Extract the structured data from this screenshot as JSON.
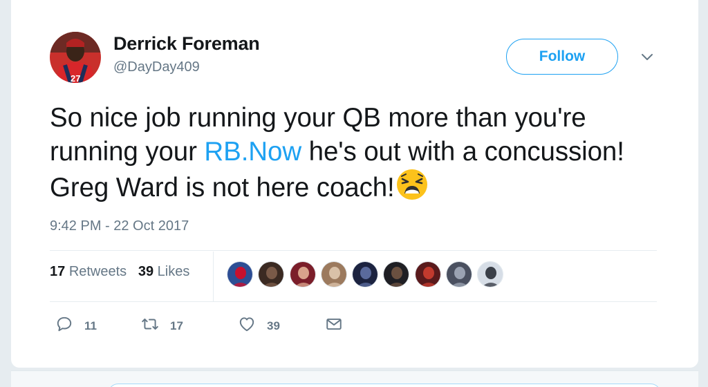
{
  "author": {
    "name": "Derrick Foreman",
    "handle": "@DayDay409",
    "avatar": "avatar"
  },
  "follow_label": "Follow",
  "menu_icon": "chevron-down-icon",
  "tweet": {
    "text_before": "So nice job running your QB more than you're running your ",
    "link": "RB.Now",
    "text_after": " he's out with a concussion! Greg Ward is not here coach!",
    "emoji": "weary-face-emoji"
  },
  "timestamp": "9:42 PM - 22 Oct 2017",
  "stats": {
    "retweets_count": "17",
    "retweets_label": "Retweets",
    "likes_count": "39",
    "likes_label": "Likes"
  },
  "likers": [
    {
      "name": "liker-avatar-1",
      "bg": "#2d4e94",
      "fg": "#c8102e"
    },
    {
      "name": "liker-avatar-2",
      "bg": "#3b2a22",
      "fg": "#7a5a48"
    },
    {
      "name": "liker-avatar-3",
      "bg": "#7b1e2a",
      "fg": "#d9a38c"
    },
    {
      "name": "liker-avatar-4",
      "bg": "#9c7a5e",
      "fg": "#d9c1a8"
    },
    {
      "name": "liker-avatar-5",
      "bg": "#1c2340",
      "fg": "#5a6a9c"
    },
    {
      "name": "liker-avatar-6",
      "bg": "#1f1f24",
      "fg": "#6a5040"
    },
    {
      "name": "liker-avatar-7",
      "bg": "#5a1a1c",
      "fg": "#c23a2e"
    },
    {
      "name": "liker-avatar-8",
      "bg": "#4a5060",
      "fg": "#9aa2b2"
    },
    {
      "name": "liker-avatar-9",
      "bg": "#d6dde6",
      "fg": "#3a3f48"
    }
  ],
  "actions": {
    "reply_count": "11",
    "retweet_count": "17",
    "like_count": "39"
  },
  "colors": {
    "accent": "#1da1f2",
    "secondary_text": "#657786",
    "page_bg": "#e6ecf0"
  }
}
